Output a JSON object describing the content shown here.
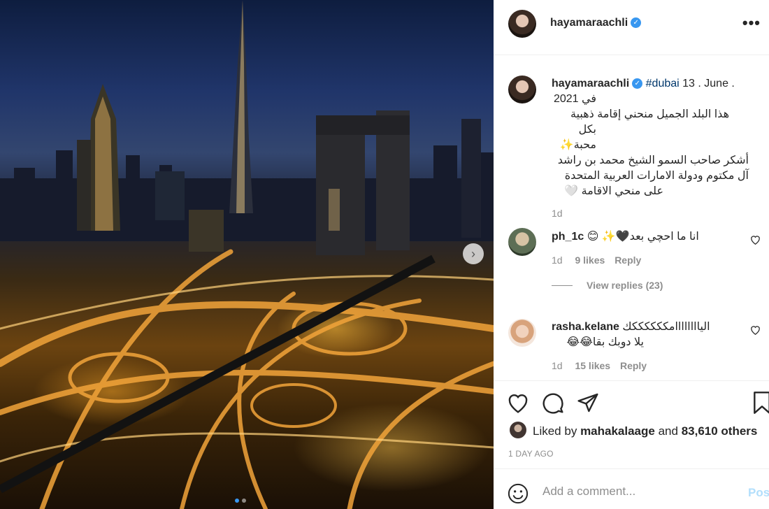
{
  "post": {
    "username": "hayamaraachli",
    "more_icon": "more-horizontal-icon"
  },
  "caption": {
    "username": "hayamaraachli",
    "hashtag": "#dubai",
    "date_line1": "13 . June .",
    "date_line2": "في 2021",
    "line3": "هذا البلد الجميل منحني إقامة ذهبية",
    "line4": "بكل محبة✨",
    "line5": "أشكر صاحب السمو الشيخ محمد بن راشد",
    "line6": "آل مكتوم ودولة الامارات العربية المتحدة",
    "line7": "على منحي الاقامة 🤍",
    "time": "1d"
  },
  "comments": [
    {
      "username": "ph_1c",
      "text": "انا ما احچي بعد🖤✨ 😊",
      "time": "1d",
      "likes": "9 likes",
      "reply": "Reply",
      "view_replies": "View replies (23)"
    },
    {
      "username": "rasha.kelane",
      "text_line1": "الياااااااامككككككك",
      "text_line2": "يلا دوبك بقا😂😂",
      "time": "1d",
      "likes": "15 likes",
      "reply": "Reply"
    }
  ],
  "actions": {
    "liked_by_prefix": "Liked by",
    "liked_by_user": "mahakalaage",
    "liked_by_middle": "and",
    "liked_by_others": "83,610 others",
    "time_ago": "1 DAY AGO"
  },
  "comment_box": {
    "placeholder": "Add a comment...",
    "post_label": "Post"
  },
  "colors": {
    "accent": "#3897f0",
    "hashtag": "#00376b",
    "muted": "#8e8e8e",
    "post_disabled": "#b2dffc"
  }
}
